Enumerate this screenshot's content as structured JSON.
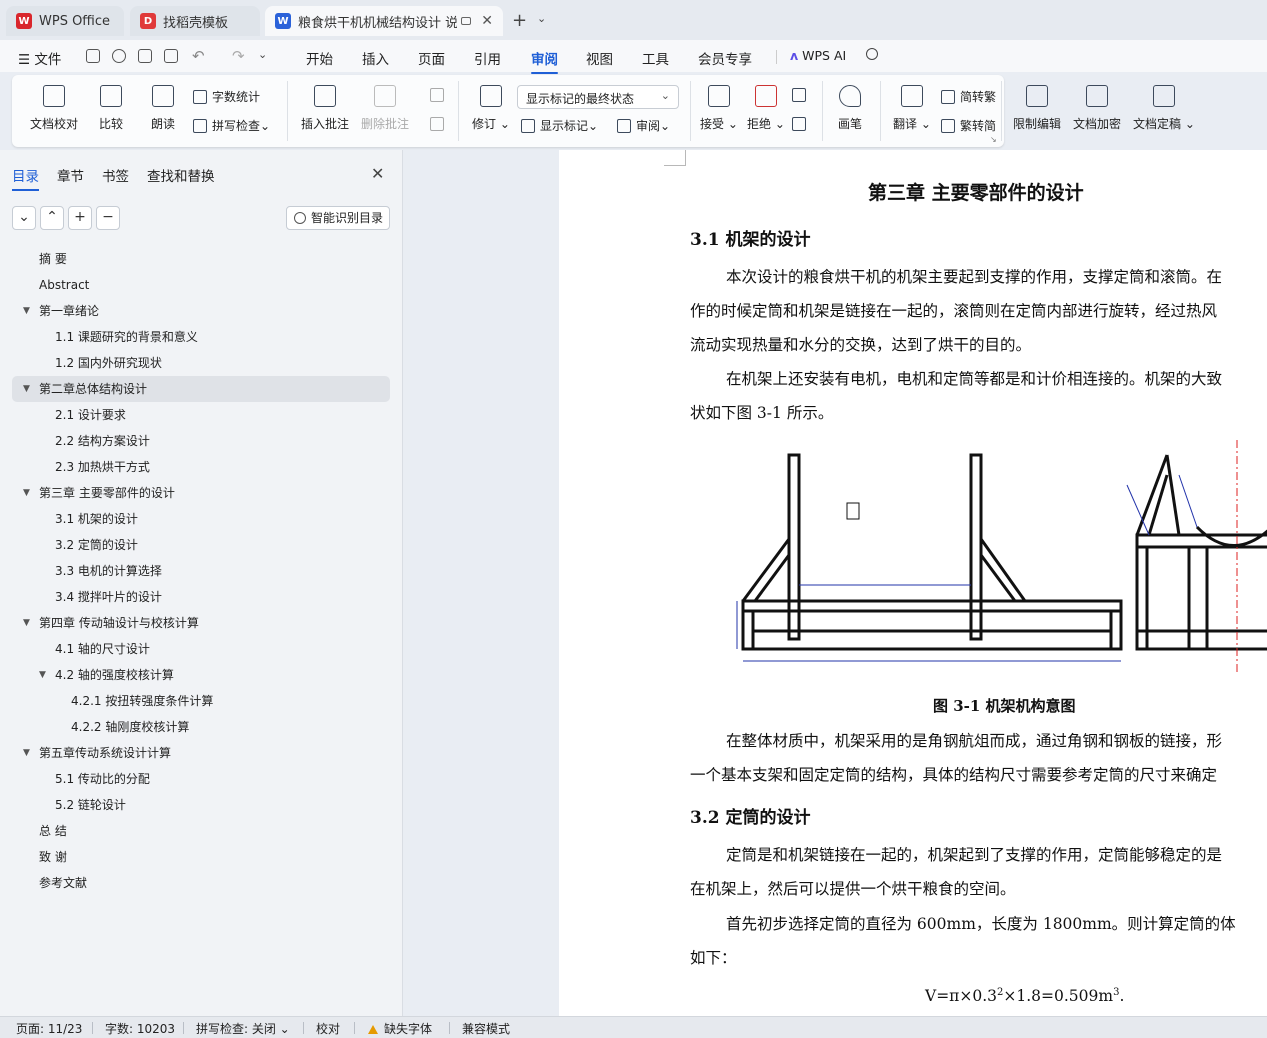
{
  "tabs": [
    {
      "label": "WPS Office",
      "logo": "W",
      "logo_color": "#d9262c"
    },
    {
      "label": "找稻壳模板",
      "logo": "D",
      "logo_color": "#e03a3a"
    },
    {
      "label": "粮食烘干机机械结构设计 说明",
      "logo": "W",
      "logo_color": "#2b62d9"
    }
  ],
  "menu": {
    "file": "文件",
    "items": [
      "开始",
      "插入",
      "页面",
      "引用",
      "审阅",
      "视图",
      "工具",
      "会员专享"
    ],
    "active": "审阅",
    "ai": "WPS AI"
  },
  "ribbon": {
    "doc_check": "文档校对",
    "compare": "比较",
    "read_aloud": "朗读",
    "word_count": "字数统计",
    "spell_check": "拼写检查",
    "insert_comment": "插入批注",
    "delete_comment": "删除批注",
    "track": "修订",
    "display_state": "显示标记的最终状态",
    "show_markup": "显示标记",
    "review": "审阅",
    "accept": "接受",
    "reject": "拒绝",
    "pen": "画笔",
    "translate": "翻译",
    "to_traditional": "简转繁",
    "to_simplified": "繁转简",
    "restrict_edit": "限制编辑",
    "encrypt": "文档加密",
    "finalize": "文档定稿"
  },
  "sidebar": {
    "tabs": [
      "目录",
      "章节",
      "书签",
      "查找和替换"
    ],
    "smart_toc": "智能识别目录",
    "toc": [
      {
        "text": "摘  要",
        "level": 0,
        "expand": false
      },
      {
        "text": "Abstract",
        "level": 0,
        "expand": false
      },
      {
        "text": "第一章绪论",
        "level": 0,
        "expand": true
      },
      {
        "text": "1.1  课题研究的背景和意义",
        "level": 1,
        "expand": false
      },
      {
        "text": "1.2  国内外研究现状",
        "level": 1,
        "expand": false
      },
      {
        "text": "第二章总体结构设计",
        "level": 0,
        "expand": true,
        "selected": true
      },
      {
        "text": "2.1  设计要求",
        "level": 1,
        "expand": false
      },
      {
        "text": "2.2  结构方案设计",
        "level": 1,
        "expand": false
      },
      {
        "text": "2.3  加热烘干方式",
        "level": 1,
        "expand": false
      },
      {
        "text": "第三章  主要零部件的设计",
        "level": 0,
        "expand": true
      },
      {
        "text": "3.1  机架的设计",
        "level": 1,
        "expand": false
      },
      {
        "text": "3.2  定筒的设计",
        "level": 1,
        "expand": false
      },
      {
        "text": "3.3 电机的计算选择",
        "level": 1,
        "expand": false
      },
      {
        "text": "3.4  搅拌叶片的设计",
        "level": 1,
        "expand": false
      },
      {
        "text": "第四章  传动轴设计与校核计算",
        "level": 0,
        "expand": true
      },
      {
        "text": "4.1  轴的尺寸设计",
        "level": 1,
        "expand": false
      },
      {
        "text": "4.2  轴的强度校核计算",
        "level": 1,
        "expand": true
      },
      {
        "text": "4.2.1  按扭转强度条件计算",
        "level": 2,
        "expand": false
      },
      {
        "text": "4.2.2 轴刚度校核计算",
        "level": 2,
        "expand": false
      },
      {
        "text": "第五章传动系统设计计算",
        "level": 0,
        "expand": true
      },
      {
        "text": "5.1  传动比的分配",
        "level": 1,
        "expand": false
      },
      {
        "text": "5.2  链轮设计",
        "level": 1,
        "expand": false
      },
      {
        "text": "总  结",
        "level": 0,
        "expand": false
      },
      {
        "text": "致  谢",
        "level": 0,
        "expand": false
      },
      {
        "text": "参考文献",
        "level": 0,
        "expand": false
      }
    ]
  },
  "document": {
    "chapter_title": "第三章  主要零部件的设计",
    "sec1_title": "3.1  机架的设计",
    "sec1_p1_l1": "本次设计的粮食烘干机的机架主要起到支撑的作用，支撑定筒和滚筒。在",
    "sec1_p1_l2": "作的时候定筒和机架是链接在一起的，滚筒则在定筒内部进行旋转，经过热风",
    "sec1_p1_l3": "流动实现热量和水分的交换，达到了烘干的目的。",
    "sec1_p2_l1": "在机架上还安装有电机，电机和定筒等都是和计价相连接的。机架的大致",
    "sec1_p2_l2": "状如下图 3-1 所示。",
    "figure_caption": "图 3-1  机架机构意图",
    "sec1_p3_l1": "在整体材质中，机架采用的是角钢航俎而成，通过角钢和钢板的链接，形",
    "sec1_p3_l2": "一个基本支架和固定定筒的结构，具体的结构尺寸需要参考定筒的尺寸来确定",
    "sec2_title": "3.2  定筒的设计",
    "sec2_p1_l1": "定筒是和机架链接在一起的，机架起到了支撑的作用，定筒能够稳定的是",
    "sec2_p1_l2": "在机架上，然后可以提供一个烘干粮食的空间。",
    "sec2_p2_l1": "首先初步选择定筒的直径为 600mm，长度为 1800mm。则计算定筒的体",
    "sec2_p2_l2": "如下：",
    "formula_main": "V=π×0.3",
    "formula_sup1": "2",
    "formula_mid": "×1.8=0.509m",
    "formula_sup2": "3",
    "formula_end": "."
  },
  "status": {
    "page": "页面: 11/23",
    "words": "字数: 10203",
    "spell": "拼写检查: 关闭",
    "proof": "校对",
    "missing_font": "缺失字体",
    "compat": "兼容模式"
  },
  "colors": {
    "accent": "#1f5fd6",
    "warning": "#e59a00"
  }
}
